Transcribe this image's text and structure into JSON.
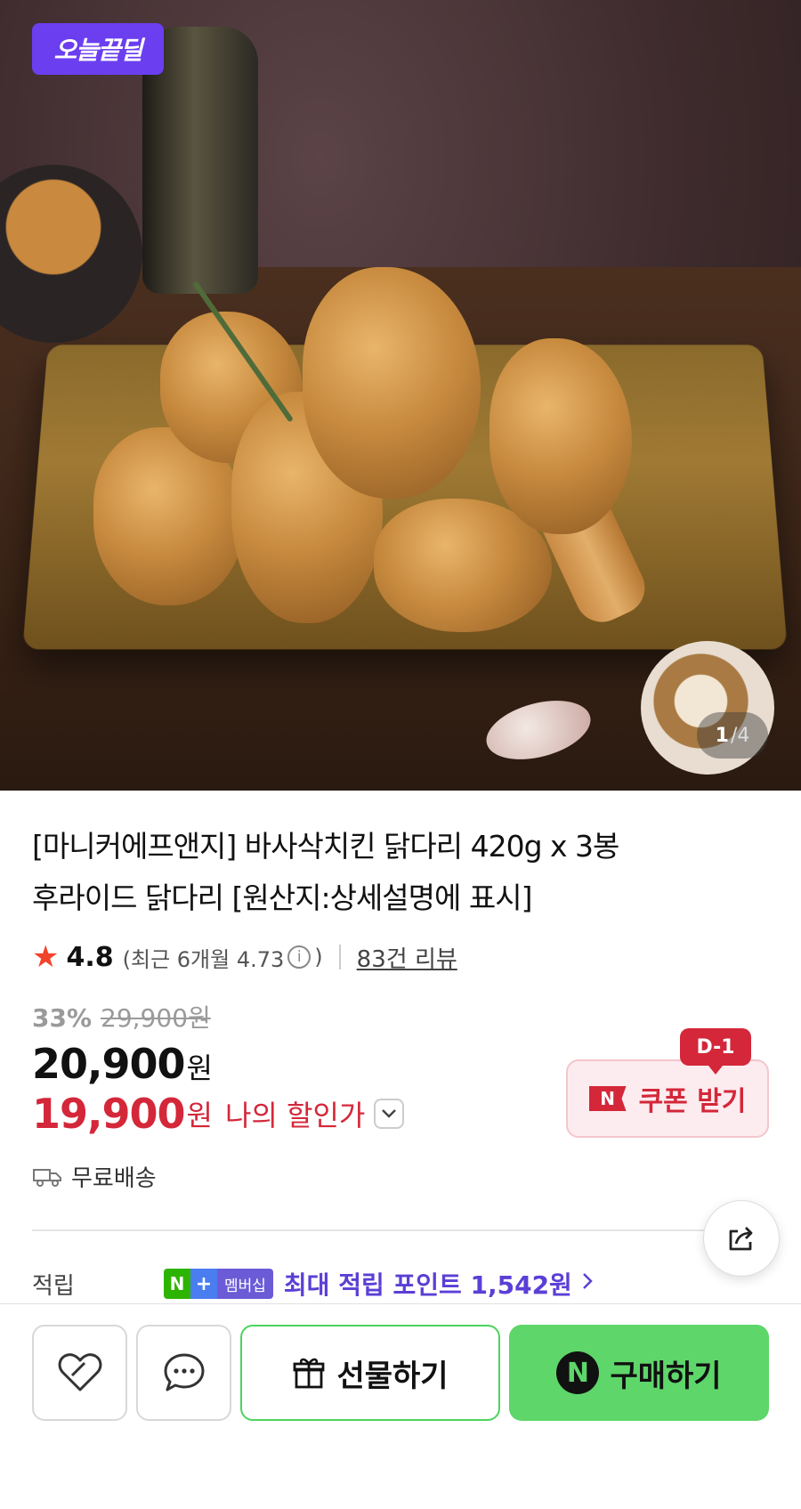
{
  "hero": {
    "badge": "오늘끝딜",
    "pager_current": "1",
    "pager_total": "/4"
  },
  "product": {
    "title_line1": "[마니커에프앤지] 바사삭치킨 닭다리 420g x 3봉",
    "title_line2": "후라이드 닭다리 [원산지:상세설명에 표시]",
    "rating": "4.8",
    "recent_rating": "(최근 6개월 4.73",
    "recent_close": ")",
    "review_count": "83건 리뷰",
    "discount_rate": "33%",
    "original_price": "29,900원",
    "price": "20,900",
    "price_unit": "원",
    "my_price": "19,900",
    "my_price_unit": "원",
    "my_price_label": "나의 할인가",
    "shipping": "무료배송"
  },
  "coupon": {
    "dday": "D-1",
    "n_mark": "N",
    "label": "쿠폰 받기"
  },
  "points": {
    "label": "적립",
    "badge_n": "N",
    "badge_plus": "+",
    "badge_text": "멤버십",
    "text": "최대 적립 포인트 1,542원"
  },
  "actions": {
    "gift": "선물하기",
    "buy_mark": "N",
    "buy": "구매하기"
  },
  "colors": {
    "accent_red": "#d4273a",
    "deal_purple": "#6b3ff0",
    "naver_green": "#5ed66a",
    "points_purple": "#5b3fd6"
  }
}
